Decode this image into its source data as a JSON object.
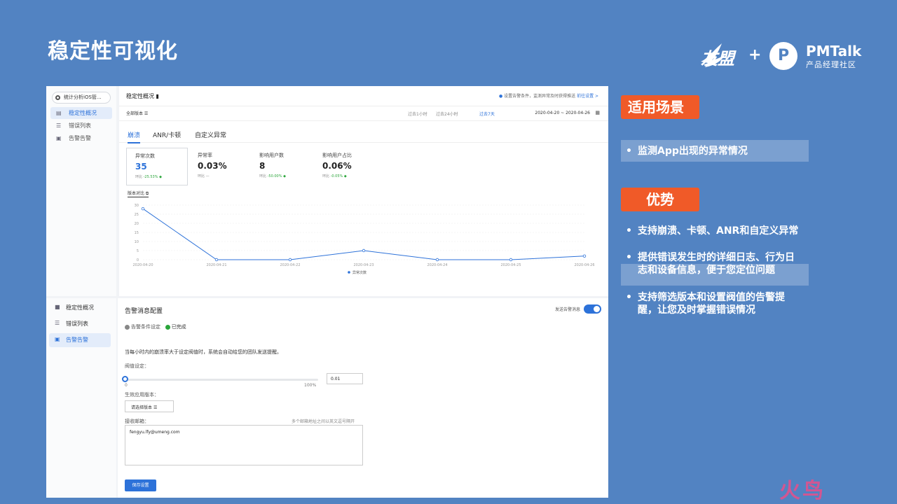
{
  "slide": {
    "title": "稳定性可视化",
    "logo_umeng": "友盟",
    "plus": "+",
    "pm_mark": "P",
    "pm_name": "PMTalk",
    "pm_sub": "产品经理社区",
    "watermark": "火鸟"
  },
  "app": {
    "app_selector": "统计分析iOS管...",
    "nav": [
      {
        "label": "稳定性概况",
        "icon": "chart-icon"
      },
      {
        "label": "错误列表",
        "icon": "list-icon"
      },
      {
        "label": "告警告警",
        "icon": "alert-icon"
      }
    ],
    "nav2": [
      {
        "label": "稳定性概况"
      },
      {
        "label": "错误列表"
      },
      {
        "label": "告警告警"
      }
    ],
    "main_title": "稳定性概况",
    "hint": "设置告警条件，监测异常及时获得推送",
    "hint_link": "前往设置 >",
    "version_filter": "全部版本",
    "ranges": [
      "过去1小时",
      "过去24小时",
      "过去7天"
    ],
    "date_range": "2020-04-20 ~ 2020-04-26",
    "tabs": [
      "崩溃",
      "ANR/卡顿",
      "自定义异常"
    ],
    "metrics": [
      {
        "label": "异常次数",
        "value": "35",
        "sub": "环比",
        "pct": "-25.53% ◆"
      },
      {
        "label": "异常率",
        "value": "0.03%",
        "sub": "环比",
        "pct": "—"
      },
      {
        "label": "影响用户数",
        "value": "8",
        "sub": "环比",
        "pct": "-50.00% ◆"
      },
      {
        "label": "影响用户占比",
        "value": "0.06%",
        "sub": "环比",
        "pct": "-0.05% ◆"
      }
    ],
    "compare_btn": "版本对比"
  },
  "chart_data": {
    "type": "line",
    "x": [
      "2020-04-20",
      "2020-04-21",
      "2020-04-22",
      "2020-04-23",
      "2020-04-24",
      "2020-04-25",
      "2020-04-26"
    ],
    "series": [
      {
        "name": "异常次数",
        "values": [
          28,
          0,
          0,
          5,
          0,
          0,
          2
        ]
      }
    ],
    "yticks": [
      0,
      5,
      10,
      15,
      20,
      25,
      30
    ],
    "ylim": [
      0,
      30
    ],
    "grid": true,
    "legend": "bottom-center",
    "color": "#2d72d9"
  },
  "alert": {
    "title": "告警消息配置",
    "toggle_label": "发送告警消息",
    "step1": "告警条件设定",
    "step2": "已完成",
    "description": "当每小时内的崩溃率大于设定阀值时，系统会自动给您的团队发送提醒。",
    "threshold_label": "阀值设定：",
    "slider_min": "0",
    "slider_max": "100%",
    "slider_value": 0,
    "threshold_value": "0.01",
    "version_label": "生效应用版本：",
    "version_placeholder": "请选择版本",
    "email_label": "接收邮箱：",
    "email_hint": "多个邮箱地址之间以英文逗号隔开",
    "email_value": "fengyu.lfy@umeng.com",
    "save_label": "保存设置"
  },
  "right": {
    "badge1": "适用场景",
    "scene": "监测App出现的异常情况",
    "badge2": "优势",
    "advantages": [
      "支持崩溃、卡顿、ANR和自定义异常",
      "提供错误发生时的详细日志、行为日志和设备信息，便于您定位问题",
      "支持筛选版本和设置阀值的告警提醒，让您及时掌握错误情况"
    ],
    "bullet_mark": "•"
  }
}
